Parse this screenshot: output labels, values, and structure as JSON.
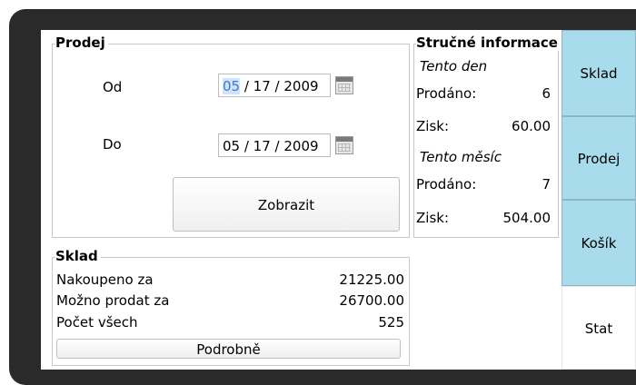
{
  "prodej": {
    "title": "Prodej",
    "od_label": "Od",
    "do_label": "Do",
    "od_date": {
      "month": "05",
      "rest": " / 17 / 2009"
    },
    "do_date": "05 / 17 / 2009",
    "zobrazit_label": "Zobrazit"
  },
  "info": {
    "title": "Stručné informace",
    "today_label": "Tento den",
    "sold_label": "Prodáno:",
    "today_sold": "6",
    "profit_label": "Zisk:",
    "today_profit": "60.00",
    "month_label": "Tento měsíc",
    "month_sold": "7",
    "month_profit": "504.00"
  },
  "sklad": {
    "title": "Sklad",
    "rows": [
      {
        "label": "Nakoupeno za",
        "value": "21225.00"
      },
      {
        "label": "Možno prodat za",
        "value": "26700.00"
      },
      {
        "label": "Počet všech",
        "value": "525"
      }
    ],
    "details_label": "Podrobně"
  },
  "tabs": [
    {
      "label": "Sklad",
      "active": true
    },
    {
      "label": "Prodej",
      "active": true
    },
    {
      "label": "Košík",
      "active": true
    },
    {
      "label": "Stat",
      "active": false
    }
  ],
  "icons": {
    "calendar": "calendar-icon"
  },
  "colors": {
    "tab_active": "#a8dcec",
    "selection": "#cfe3ff",
    "bezel": "#2a2a2a"
  }
}
